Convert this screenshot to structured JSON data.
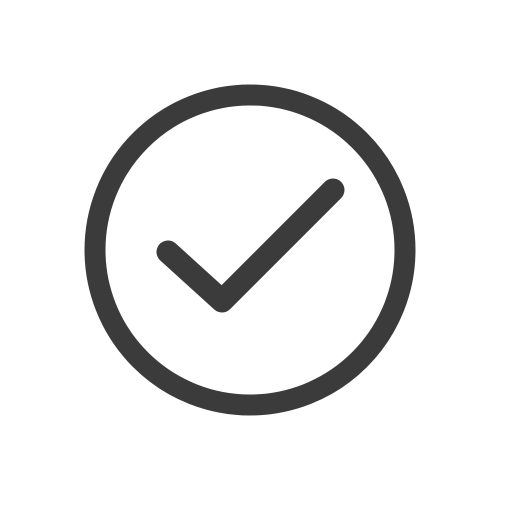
{
  "icon": {
    "name": "check-circle-icon",
    "color": "#3b3b3b",
    "background": "#ffffff"
  }
}
